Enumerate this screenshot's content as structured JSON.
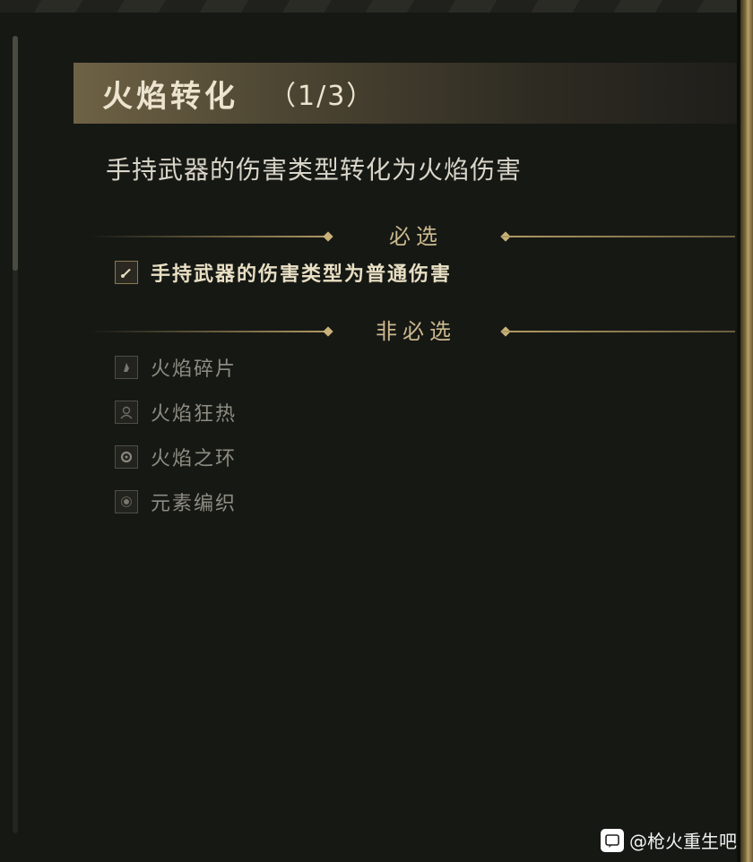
{
  "title": {
    "name": "火焰转化",
    "count": "（1/3）"
  },
  "description": "手持武器的伤害类型转化为火焰伤害",
  "sections": {
    "required": {
      "label": "必选",
      "items": [
        {
          "label": "手持武器的伤害类型为普通伤害",
          "icon": "weapon-icon"
        }
      ]
    },
    "optional": {
      "label": "非必选",
      "items": [
        {
          "label": "火焰碎片",
          "icon": "fire-shard-icon"
        },
        {
          "label": "火焰狂热",
          "icon": "fire-frenzy-icon"
        },
        {
          "label": "火焰之环",
          "icon": "fire-ring-icon"
        },
        {
          "label": "元素编织",
          "icon": "element-weave-icon"
        }
      ]
    }
  },
  "watermark": {
    "text": "@枪火重生吧"
  },
  "colors": {
    "gold": "#b19a63",
    "background": "#161814",
    "title_text": "#ece4cf",
    "muted_text": "#8e8c82"
  }
}
